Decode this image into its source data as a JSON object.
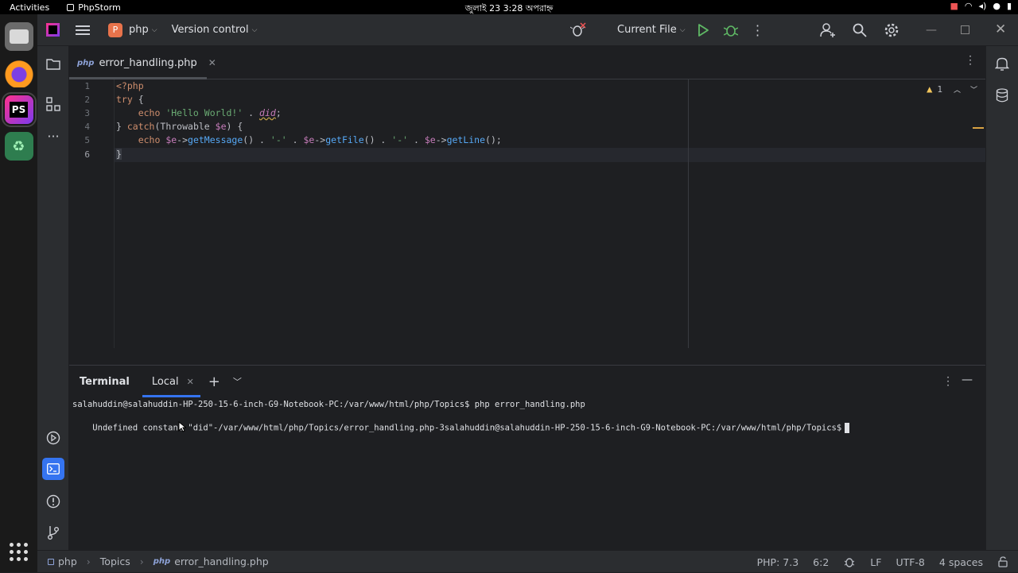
{
  "system": {
    "activities": "Activities",
    "app_name": "PhpStorm",
    "clock": "জুলাই 23  3:28 অপরাহ্ন"
  },
  "toolbar": {
    "project_letter": "P",
    "project": "php",
    "vcs": "Version control",
    "run_config": "Current File"
  },
  "editor": {
    "tab_badge": "php",
    "tab_name": "error_handling.php",
    "warning_count": "1",
    "line_numbers": [
      "1",
      "2",
      "3",
      "4",
      "5",
      "6"
    ],
    "code": {
      "l1": "<?php",
      "l2_kw": "try",
      "l2_rest": " {",
      "l3_echo": "    echo ",
      "l3_str": "'Hello World!'",
      "l3_dot": " . ",
      "l3_const": "did",
      "l3_end": ";",
      "l4_a": "} ",
      "l4_catch": "catch",
      "l4_b": "(Throwable ",
      "l4_var": "$e",
      "l4_c": ") {",
      "l5_echo": "    echo ",
      "l5_v1": "$e",
      "l5_arrow1": "->",
      "l5_f1": "getMessage",
      "l5_p1": "() . ",
      "l5_s1": "'-'",
      "l5_d1": " . ",
      "l5_v2": "$e",
      "l5_arrow2": "->",
      "l5_f2": "getFile",
      "l5_p2": "() . ",
      "l5_s2": "'-'",
      "l5_d2": " . ",
      "l5_v3": "$e",
      "l5_arrow3": "->",
      "l5_f3": "getLine",
      "l5_p3": "();",
      "l6": "}"
    }
  },
  "terminal": {
    "title": "Terminal",
    "tab": "Local",
    "line1": "salahuddin@salahuddin-HP-250-15-6-inch-G9-Notebook-PC:/var/www/html/php/Topics$ php error_handling.php",
    "line2": "Undefined constant \"did\"-/var/www/html/php/Topics/error_handling.php-3salahuddin@salahuddin-HP-250-15-6-inch-G9-Notebook-PC:/var/www/html/php/Topics$"
  },
  "status": {
    "crumb_project": "php",
    "crumb_folder": "Topics",
    "crumb_badge": "php",
    "crumb_file": "error_handling.php",
    "php_version": "PHP: 7.3",
    "position": "6:2",
    "line_sep": "LF",
    "encoding": "UTF-8",
    "indent": "4 spaces"
  },
  "colors": {
    "accent": "#3574f0",
    "project_badge": "#e8734b",
    "run_green": "#5fb865",
    "warning": "#f2c55c"
  }
}
